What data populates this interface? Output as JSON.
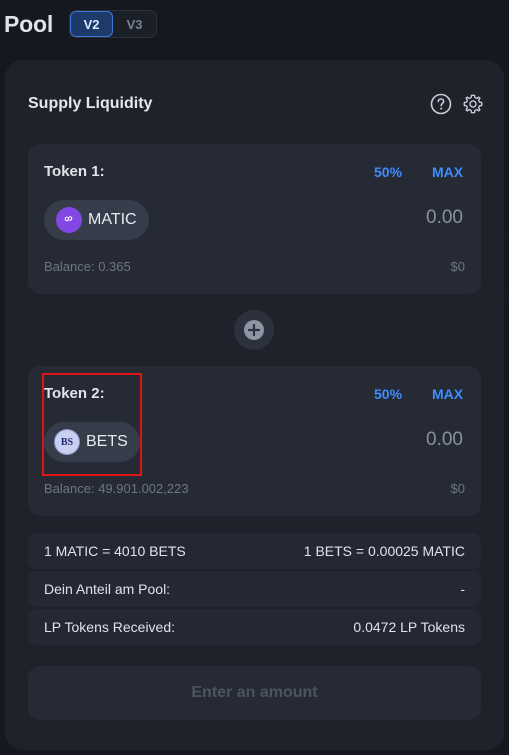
{
  "header": {
    "title": "Pool",
    "versions": [
      "V2",
      "V3"
    ],
    "active_version": "V2"
  },
  "card": {
    "title": "Supply Liquidity",
    "icons": [
      "help-circle-icon",
      "gear-icon"
    ]
  },
  "token1": {
    "label": "Token 1:",
    "pct_label": "50%",
    "max_label": "MAX",
    "symbol": "MATIC",
    "amount_placeholder": "0.00",
    "balance": "Balance: 0.365",
    "usd": "$0"
  },
  "token2": {
    "label": "Token 2:",
    "pct_label": "50%",
    "max_label": "MAX",
    "symbol": "BETS",
    "logo_text": "BS",
    "amount_placeholder": "0.00",
    "balance": "Balance: 49.901.002,223",
    "usd": "$0"
  },
  "info": {
    "rate_left": "1 MATIC = 4010 BETS",
    "rate_right": "1 BETS = 0.00025 MATIC",
    "share_label": "Dein Anteil am Pool:",
    "share_value": "-",
    "lp_label": "LP Tokens Received:",
    "lp_value": "0.0472 LP Tokens"
  },
  "submit_label": "Enter an amount",
  "colors": {
    "accent": "#3f8cff",
    "highlight": "#e01414",
    "matic": "#8247e5"
  }
}
